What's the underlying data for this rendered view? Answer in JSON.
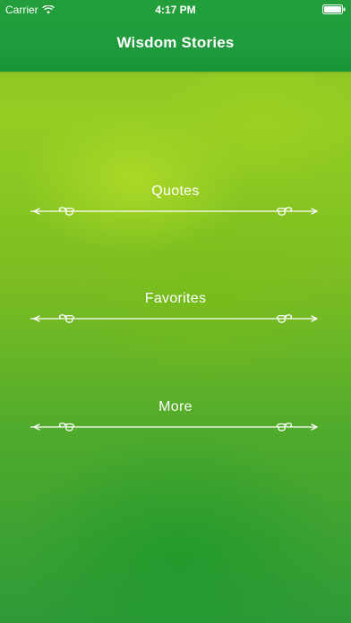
{
  "status_bar": {
    "carrier": "Carrier",
    "time": "4:17 PM"
  },
  "nav": {
    "title": "Wisdom Stories"
  },
  "menu": {
    "items": [
      {
        "label": "Quotes"
      },
      {
        "label": "Favorites"
      },
      {
        "label": "More"
      }
    ]
  },
  "colors": {
    "header": "#1f9b3d",
    "text": "#ffffff",
    "background_top": "#8ec826",
    "background_bottom": "#2e9a38"
  }
}
